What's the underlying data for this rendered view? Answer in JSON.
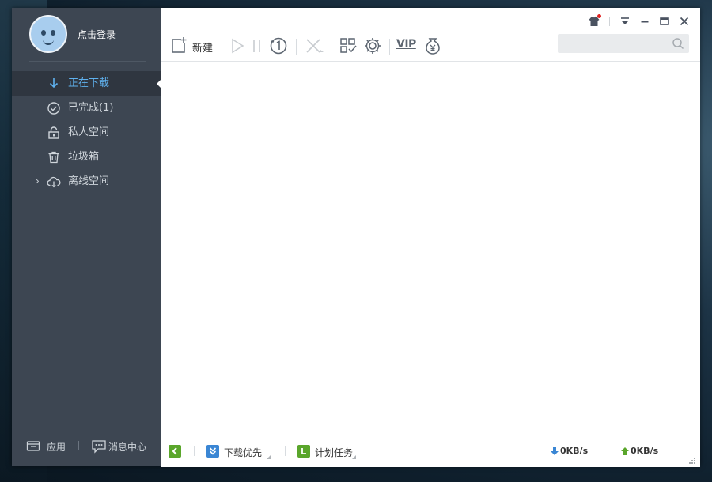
{
  "sidebar": {
    "login_text": "点击登录",
    "items": [
      {
        "label": "正在下载",
        "icon": "download-arrow-icon",
        "active": true
      },
      {
        "label": "已完成(1)",
        "icon": "check-circle-icon",
        "active": false
      },
      {
        "label": "私人空间",
        "icon": "lock-icon",
        "active": false
      },
      {
        "label": "垃圾箱",
        "icon": "trash-icon",
        "active": false
      },
      {
        "label": "离线空间",
        "icon": "cloud-download-icon",
        "active": false,
        "expandable": true
      }
    ],
    "bottom": {
      "apps_label": "应用",
      "messages_label": "消息中心"
    }
  },
  "toolbar": {
    "new_label": "新建",
    "vip_label": "VIP",
    "search_placeholder": ""
  },
  "statusbar": {
    "download_priority_label": "下载优先",
    "scheduled_task_label": "计划任务",
    "download_speed": "0KB/s",
    "upload_speed": "0KB/s"
  },
  "colors": {
    "sidebar_bg": "#3d4652",
    "active_item_bg": "#2f3640",
    "accent_blue": "#5fb1ee",
    "green": "#5aa62b",
    "notification_dot": "#e02020"
  }
}
